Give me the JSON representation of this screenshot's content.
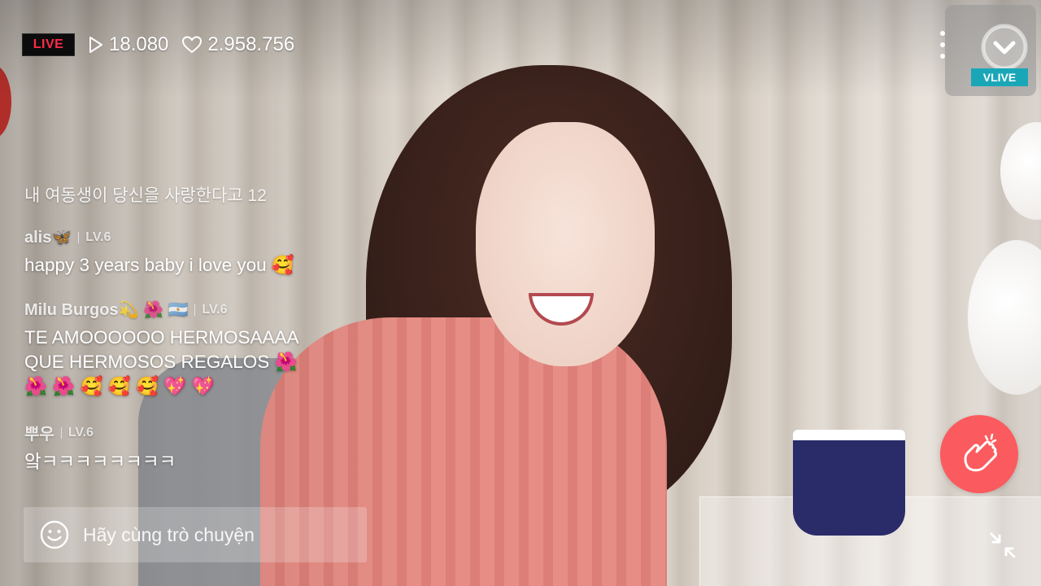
{
  "stream": {
    "live_label": "LIVE",
    "views": "18.080",
    "likes": "2.958.756"
  },
  "brand": {
    "logo_text": "VLIVE"
  },
  "chat": {
    "system_message": "내 여동생이 당신을 사랑한다고 12",
    "messages": [
      {
        "user": "alis🦋",
        "level": "LV.6",
        "text": "happy 3 years baby i love you 🥰"
      },
      {
        "user": "Milu Burgos💫 🌺 🇦🇷",
        "level": "LV.6",
        "text": "TE AMOOOOOO HERMOSAAAA\nQUE HERMOSOS REGALOS 🌺\n🌺 🌺 🥰 🥰 🥰 💖 💖"
      },
      {
        "user": "뿌우",
        "level": "LV.6",
        "text": "앜ㅋㅋㅋㅋㅋㅋㅋㅋ"
      }
    ],
    "input_placeholder": "Hãy cùng trò chuyện"
  },
  "colors": {
    "live_red": "#ff2a4a",
    "heart_button": "#fb5b5e",
    "vlive_teal": "#19a7b8"
  }
}
